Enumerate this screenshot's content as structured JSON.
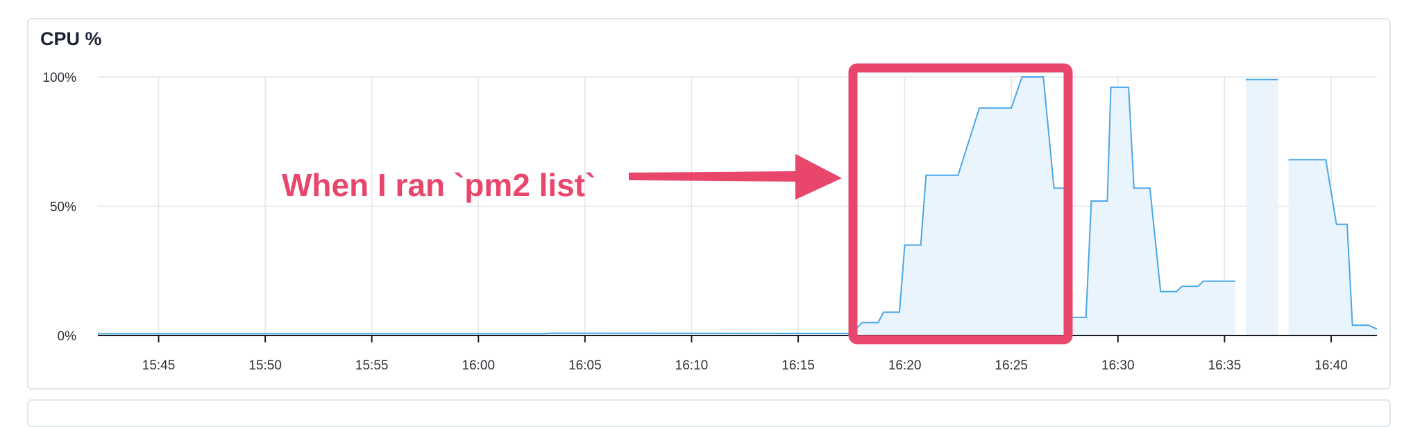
{
  "title": "CPU %",
  "colors": {
    "line": "#4aa7e8",
    "fill": "#eaf4fc",
    "grid": "#e2e5ea",
    "axis": "#1a1a1a",
    "annotation": "#e8466b"
  },
  "annotation": {
    "text": "When I ran `pm2 list`"
  },
  "chart_data": {
    "type": "area",
    "title": "CPU %",
    "xlabel": "",
    "ylabel": "",
    "x_tick_labels": [
      "15:45",
      "15:50",
      "15:55",
      "16:00",
      "16:05",
      "16:10",
      "16:15",
      "16:20",
      "16:25",
      "16:30",
      "16:35",
      "16:40"
    ],
    "y_tick_labels": [
      "0%",
      "50%",
      "100%"
    ],
    "ylim": [
      0,
      100
    ],
    "xlim": [
      "15:42:09",
      "16:42:09"
    ],
    "grid": true,
    "series": [
      {
        "points": [
          [
            "15:42:09",
            0.7
          ],
          [
            "16:03:00",
            0.7
          ],
          [
            "16:03:30",
            0.9
          ],
          [
            "16:17:30",
            0.8
          ],
          [
            "16:18:00",
            5
          ],
          [
            "16:18:45",
            5
          ],
          [
            "16:19:00",
            9
          ],
          [
            "16:19:45",
            9
          ],
          [
            "16:20:00",
            35
          ],
          [
            "16:20:45",
            35
          ],
          [
            "16:21:00",
            62
          ],
          [
            "16:22:30",
            62
          ],
          [
            "16:23:30",
            88
          ],
          [
            "16:25:00",
            88
          ],
          [
            "16:25:30",
            100
          ],
          [
            "16:26:30",
            100
          ],
          [
            "16:27:00",
            57
          ],
          [
            "16:27:30",
            57
          ],
          [
            "16:27:45",
            7
          ],
          [
            "16:28:30",
            7
          ],
          [
            "16:28:45",
            52
          ],
          [
            "16:29:30",
            52
          ],
          [
            "16:29:40",
            96
          ],
          [
            "16:30:30",
            96
          ],
          [
            "16:30:45",
            57
          ],
          [
            "16:31:30",
            57
          ],
          [
            "16:32:00",
            17
          ],
          [
            "16:32:45",
            17
          ],
          [
            "16:33:00",
            19
          ],
          [
            "16:33:45",
            19
          ],
          [
            "16:34:00",
            21
          ],
          [
            "16:35:30",
            21
          ]
        ]
      },
      {
        "points": [
          [
            "16:36:00",
            99
          ],
          [
            "16:37:30",
            99
          ]
        ]
      },
      {
        "points": [
          [
            "16:38:00",
            68
          ],
          [
            "16:39:45",
            68
          ],
          [
            "16:40:15",
            43
          ],
          [
            "16:40:45",
            43
          ],
          [
            "16:41:00",
            4
          ],
          [
            "16:41:45",
            4
          ],
          [
            "16:42:09",
            2.5
          ]
        ]
      }
    ]
  }
}
